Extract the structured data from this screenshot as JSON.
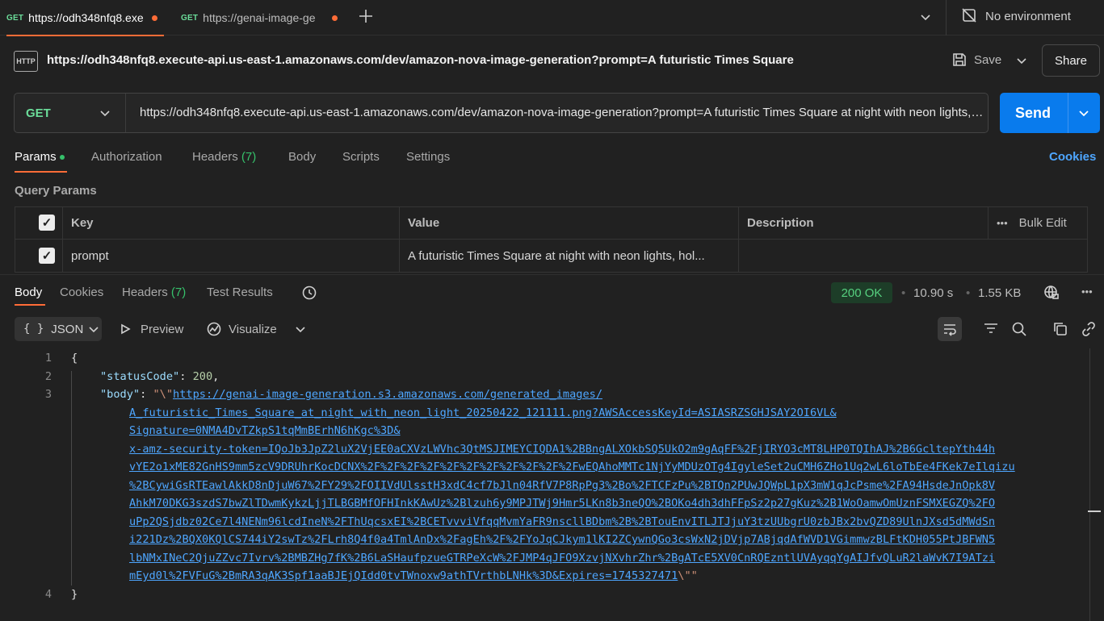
{
  "tabs": [
    {
      "method": "GET",
      "label": "https://odh348nfq8.exe",
      "active": true
    },
    {
      "method": "GET",
      "label": "https://genai-image-ge",
      "active": false
    }
  ],
  "environment": {
    "label": "No environment"
  },
  "request": {
    "title": "https://odh348nfq8.execute-api.us-east-1.amazonaws.com/dev/amazon-nova-image-generation?prompt=A futuristic Times Square",
    "save_label": "Save",
    "share_label": "Share",
    "method": "GET",
    "url": "https://odh348nfq8.execute-api.us-east-1.amazonaws.com/dev/amazon-nova-image-generation?prompt=A futuristic Times Square at night with neon lights, holographic billboards",
    "send_label": "Send"
  },
  "request_tabs": {
    "params": "Params",
    "authorization": "Authorization",
    "headers": "Headers",
    "headers_count": "(7)",
    "body": "Body",
    "scripts": "Scripts",
    "settings": "Settings",
    "cookies": "Cookies"
  },
  "query_params": {
    "section_label": "Query Params",
    "columns": {
      "key": "Key",
      "value": "Value",
      "description": "Description",
      "bulk_edit": "Bulk Edit"
    },
    "rows": [
      {
        "key": "prompt",
        "value": "A futuristic Times Square at night with neon lights, hol...",
        "description": ""
      }
    ]
  },
  "response_tabs": {
    "body": "Body",
    "cookies": "Cookies",
    "headers": "Headers",
    "headers_count": "(7)",
    "test_results": "Test Results"
  },
  "response_meta": {
    "status": "200 OK",
    "time": "10.90 s",
    "size": "1.55 KB",
    "status_color": "#56d07f"
  },
  "response_toolbar": {
    "format": "JSON",
    "preview": "Preview",
    "visualize": "Visualize"
  },
  "code": {
    "line_numbers": [
      "1",
      "2",
      "3",
      "4"
    ],
    "open_brace": "{",
    "close_brace": "}",
    "status_key": "\"statusCode\"",
    "status_value": "200",
    "body_key": "\"body\"",
    "body_prefix": "\"\\\"",
    "body_suffix": "\\\"\"",
    "url_lines": [
      "https://genai-image-generation.s3.amazonaws.com/generated_images/",
      "A_futuristic_Times_Square_at_night_with_neon_light_20250422_121111.png?AWSAccessKeyId=ASIASRZSGHJSAY2OI6VL&",
      "Signature=0NMA4DvTZkpS1tqMmBErhN6hKgc%3D&",
      "x-amz-security-token=IQoJb3JpZ2luX2VjEE0aCXVzLWVhc3QtMSJIMEYCIQDA1%2BBngALXOkbSQ5UkO2m9gAqFF%2FjIRYO3cMT8LHP0TQIhAJ%2B6GcltepYth44h",
      "vYE2o1xME82GnHS9mm5zcV9DRUhrKocDCNX%2F%2F%2F%2F%2F%2F%2F%2F%2F%2F%2FwEQAhoMMTc1NjYyMDUzOTg4IgyleSet2uCMH6ZHo1Uq2wL6loTbEe4FKek7eIlqizu",
      "%2BCywiGsRTEawlAkkD8nDjuW67%2FY29%2FOIIVdUlsstH3xdC4cf7bJln04RfV7P8RpPg3%2Bo%2FTCFzPu%2BTQn2PUwJQWpL1pX3mW1qJcPsme%2FA94HsdeJnOpk8V",
      "AhkM70DKG3szdS7bwZlTDwmKykzLjjTLBGBMfOFHInkKAwUz%2Blzuh6y9MPJTWj9Hmr5LKn8b3neQO%2BOKo4dh3dhFFpSz2p27gKuz%2B1WoOamwOmUznFSMXEGZQ%2FO",
      "uPp2QSjdbz02Ce7l4NENm96lcdIneN%2FThUqcsxEI%2BCETvvviVfqqMvmYaFR9nscllBDbm%2B%2BTouEnvITLJTJjuY3tzUUbgrU0zbJBx2bvQZD89UlnJXsd5dMWdSn",
      "i221Dz%2BQX0KQlCS744iY2swTz%2FLrh8Q4f0a4TmlAnDx%2FagEh%2F%2FYoJqCJkym1lKI2ZCywnQGo3csWxN2jDVjp7ABjqdAfWVD1VGimmwzBLFtKDH055PtJBFWN5",
      "lbNMxINeC2QjuZZvc7Ivrv%2BMBZHg7fK%2B6LaSHaufpzueGTRPeXcW%2FJMP4qJFO9XzvjNXvhrZhr%2BgATcE5XV0CnRQEzntlUVAyqqYgAIJfvQLuR2laWvK7I9ATzi",
      "mEyd0l%2FVFuG%2BmRA3qAK3Spf1aaBJEjQIdd0tvTWnoxw9athTVrthbLNHk%3D&Expires=1745327471"
    ]
  }
}
